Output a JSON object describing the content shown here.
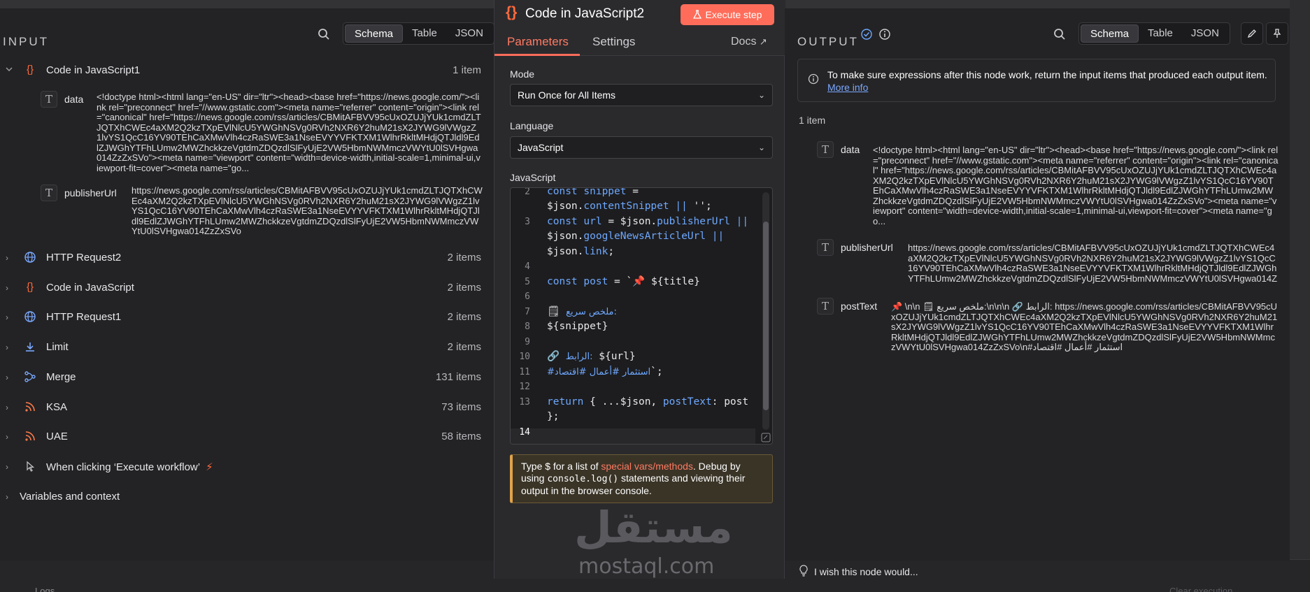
{
  "input": {
    "title": "INPUT",
    "tabs": [
      "Schema",
      "Table",
      "JSON"
    ],
    "active_tab": "Schema",
    "expanded_node": {
      "name": "Code in JavaScript1",
      "count": "1 item",
      "fields": [
        {
          "name": "data",
          "value": "<!doctype html><html lang=\"en-US\" dir=\"ltr\"><head><base href=\"https://news.google.com/\"><link rel=\"preconnect\" href=\"//www.gstatic.com\"><meta name=\"referrer\" content=\"origin\"><link rel=\"canonical\" href=\"https://news.google.com/rss/articles/CBMitAFBVV95cUxOZUJjYUk1cmdZLTJQTXhCWEc4aXM2Q2kzTXpEVlNlcU5YWGhNSVg0RVh2NXR6Y2huM21sX2JYWG9lVWgzZ1lvYS1QcC16YV90TEhCaXMwVlh4czRaSWE3a1NseEVYYVFKTXM1WlhrRkltMHdjQTJldl9EdlZJWGhYTFhLUmw2MWZhckkzeVgtdmZDQzdlSlFyUjE2VW5HbmNWMmczVWYtU0lSVHgwa014ZzZxSVo\"><meta name=\"viewport\" content=\"width=device-width,initial-scale=1,minimal-ui,viewport-fit=cover\"><meta name=\"go..."
        },
        {
          "name": "publisherUrl",
          "value": "https://news.google.com/rss/articles/CBMitAFBVV95cUxOZUJjYUk1cmdZLTJQTXhCWEc4aXM2Q2kzTXpEVlNlcU5YWGhNSVg0RVh2NXR6Y2huM21sX2JYWG9lVWgzZ1lvYS1QcC16YV90TEhCaXMwVlh4czRaSWE3a1NseEVYYVFKTXM1WlhrRkltMHdjQTJldl9EdlZJWGhYTFhLUmw2MWZhckkzeVgtdmZDQzdlSlFyUjE2VW5HbmNWMmczVWYtU0lSVHgwa014ZzZxSVo"
        }
      ]
    },
    "nodes": [
      {
        "name": "HTTP Request2",
        "count": "2 items",
        "icon": "globe-icon"
      },
      {
        "name": "Code in JavaScript",
        "count": "2 items",
        "icon": "code-braces-icon"
      },
      {
        "name": "HTTP Request1",
        "count": "2 items",
        "icon": "globe-icon"
      },
      {
        "name": "Limit",
        "count": "2 items",
        "icon": "limit-icon"
      },
      {
        "name": "Merge",
        "count": "131 items",
        "icon": "merge-icon"
      },
      {
        "name": "KSA",
        "count": "73 items",
        "icon": "rss-icon"
      },
      {
        "name": "UAE",
        "count": "58 items",
        "icon": "rss-icon"
      },
      {
        "name": "When clicking ‘Execute workflow’",
        "count": "",
        "icon": "cursor-icon"
      }
    ],
    "variables_label": "Variables and context"
  },
  "center": {
    "title": "Code in JavaScript2",
    "execute_label": "Execute step",
    "tabs": [
      "Parameters",
      "Settings"
    ],
    "docs_label": "Docs",
    "mode_label": "Mode",
    "mode_value": "Run Once for All Items",
    "language_label": "Language",
    "language_value": "JavaScript",
    "code_label": "JavaScript",
    "code_lines": [
      {
        "n": "2",
        "t": "const snippet ="
      },
      {
        "n": "",
        "t": "$json.contentSnippet || '';"
      },
      {
        "n": "3",
        "t": "const url = $json.publisherUrl ||"
      },
      {
        "n": "",
        "t": "$json.googleNewsArticleUrl ||"
      },
      {
        "n": "",
        "t": "$json.link;"
      },
      {
        "n": "4",
        "t": ""
      },
      {
        "n": "5",
        "t": "const post = `📌 ${title}"
      },
      {
        "n": "6",
        "t": ""
      },
      {
        "n": "7",
        "t": "🗒 ملخص سريع:"
      },
      {
        "n": "8",
        "t": "${snippet}"
      },
      {
        "n": "9",
        "t": ""
      },
      {
        "n": "10",
        "t": "🔗 الرابط: ${url}"
      },
      {
        "n": "11",
        "t": "#استثمار #أعمال #اقتصاد`;"
      },
      {
        "n": "12",
        "t": ""
      },
      {
        "n": "13",
        "t": "return { ...$json, postText: post"
      },
      {
        "n": "",
        "t": "};"
      },
      {
        "n": "14",
        "t": ""
      }
    ],
    "tip_prefix": "Type $ for a list of ",
    "tip_link": "special vars/methods",
    "tip_mid": ". Debug by using ",
    "tip_code": "console.log()",
    "tip_suffix": " statements and viewing their output in the browser console.",
    "watermark_ar": "مستقل",
    "watermark_en": "mostaql.com"
  },
  "output": {
    "title": "OUTPUT",
    "tabs": [
      "Schema",
      "Table",
      "JSON"
    ],
    "active_tab": "Schema",
    "info_text": "To make sure expressions after this node work, return the input items that produced each output item.",
    "info_link": "More info",
    "count": "1 item",
    "fields": [
      {
        "name": "data",
        "value": "<!doctype html><html lang=\"en-US\" dir=\"ltr\"><head><base href=\"https://news.google.com/\"><link rel=\"preconnect\" href=\"//www.gstatic.com\"><meta name=\"referrer\" content=\"origin\"><link rel=\"canonical\" href=\"https://news.google.com/rss/articles/CBMitAFBVV95cUxOZUJjYUk1cmdZLTJQTXhCWEc4aXM2Q2kzTXpEVlNlcU5YWGhNSVg0RVh2NXR6Y2huM21sX2JYWG9lVWgzZ1lvYS1QcC16YV90TEhCaXMwVlh4czRaSWE3a1NseEVYYVFKTXM1WlhrRkltMHdjQTJldl9EdlZJWGhYTFhLUmw2MWZhckkzeVgtdmZDQzdlSlFyUjE2VW5HbmNWMmczVWYtU0lSVHgwa014ZzZxSVo\"><meta name=\"viewport\" content=\"width=device-width,initial-scale=1,minimal-ui,viewport-fit=cover\"><meta name=\"go..."
      },
      {
        "name": "publisherUrl",
        "value": "https://news.google.com/rss/articles/CBMitAFBVV95cUxOZUJjYUk1cmdZLTJQTXhCWEc4aXM2Q2kzTXpEVlNlcU5YWGhNSVg0RVh2NXR6Y2huM21sX2JYWG9lVWgzZ1lvYS1QcC16YV90TEhCaXMwVlh4czRaSWE3a1NseEVYYVFKTXM1WlhrRkltMHdjQTJldl9EdlZJWGhYTFhLUmw2MWZhckkzeVgtdmZDQzdlSlFyUjE2VW5HbmNWMmczVWYtU0lSVHgwa014ZzZxSVo"
      },
      {
        "name": "postText",
        "value": "📌 \\n\\n 🗒 ملخص سريع:\\n\\n\\n 🔗 الرابط: https://news.google.com/rss/articles/CBMitAFBVV95cUxOZUJjYUk1cmdZLTJQTXhCWEc4aXM2Q2kzTXpEVlNlcU5YWGhNSVg0RVh2NXR6Y2huM21sX2JYWG9lVWgzZ1lvYS1QcC16YV90TEhCaXMwVlh4czRaSWE3a1NseEVYYVFKTXM1WlhrRkltMHdjQTJldl9EdlZJWGhYTFhLUmw2MWZhckkzeVgtdmZDQzdlSlFyUjE2VW5HbmNWMmczVWYtU0lSVHgwa014ZzZxSVo\\n#استثمار #أعمال #اقتصاد"
      }
    ]
  },
  "footer": {
    "wish_text": "I wish this node would...",
    "logs_label": "Logs",
    "clear_label": "Clear execution"
  },
  "colors": {
    "accent": "#ff6d5a",
    "link": "#7aa8ff",
    "code_var": "#6ea8ff"
  }
}
